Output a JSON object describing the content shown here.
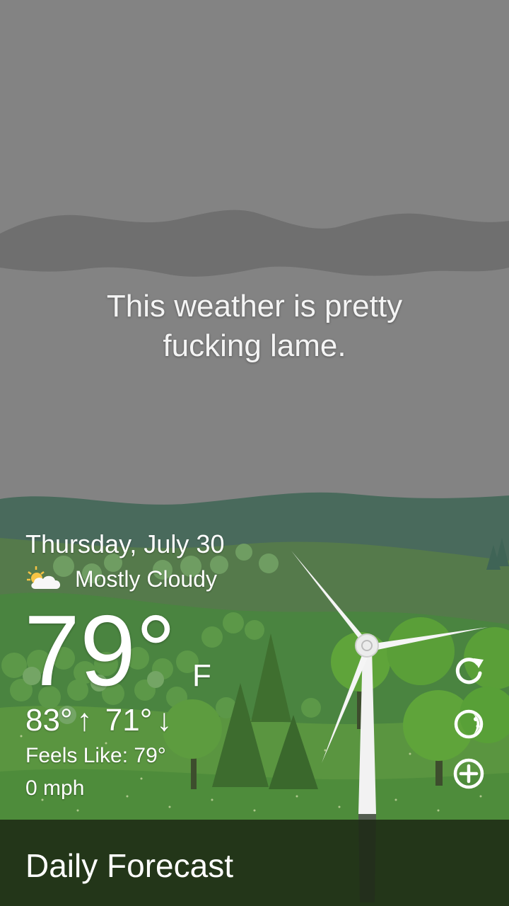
{
  "message": {
    "line1": "This weather is pretty",
    "line2": "fucking lame."
  },
  "weather": {
    "date": "Thursday, July 30",
    "condition": "Mostly Cloudy",
    "condition_icon": "partly-cloudy-icon",
    "temperature": "79°",
    "unit": "F",
    "high": "83°",
    "high_arrow": "↑",
    "low": "71°",
    "low_arrow": "↓",
    "feels_like": "Feels Like: 79°",
    "wind": "0 mph"
  },
  "actions": [
    {
      "name": "refresh-icon"
    },
    {
      "name": "theme-icon"
    },
    {
      "name": "add-location-icon"
    }
  ],
  "footer": {
    "label": "Daily Forecast"
  },
  "colors": {
    "sky": "#838383",
    "cloud_band": "#6f6f6f",
    "hills_far": "#47675a",
    "meadow": "#4f8a37",
    "footer": "#1c2814"
  }
}
